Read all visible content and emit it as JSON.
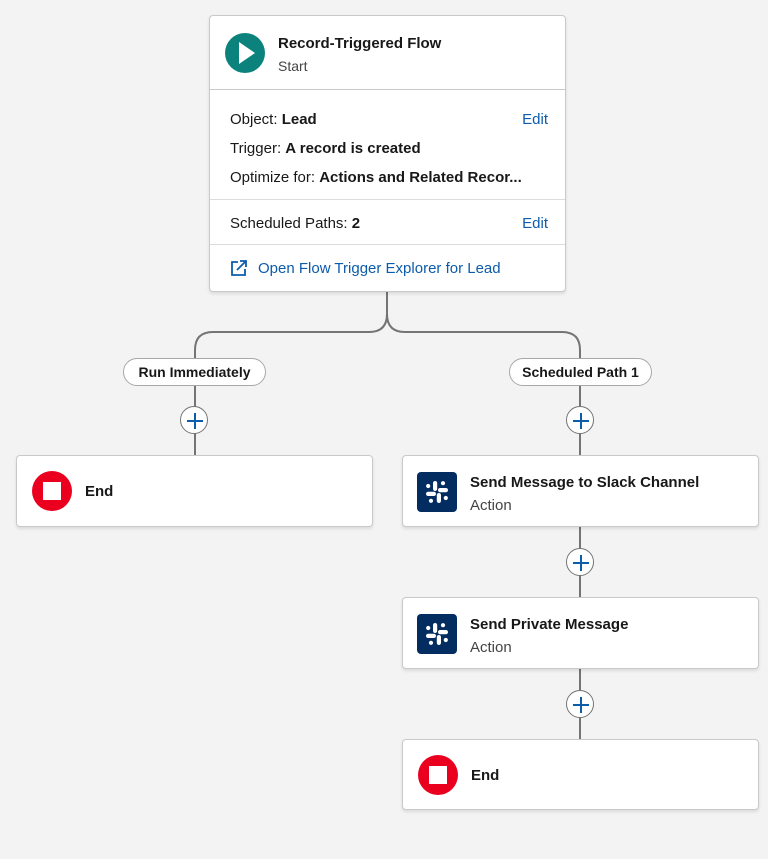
{
  "start": {
    "title": "Record-Triggered Flow",
    "subtitle": "Start",
    "object_label": "Object: ",
    "object_value": "Lead",
    "trigger_label": "Trigger: ",
    "trigger_value": "A record is created",
    "optimize_label": "Optimize for: ",
    "optimize_value": "Actions and Related Recor...",
    "edit_label": "Edit",
    "scheduled_label": "Scheduled Paths: ",
    "scheduled_value": "2",
    "scheduled_edit_label": "Edit",
    "explorer_link": "Open Flow Trigger Explorer for Lead"
  },
  "paths": {
    "left_label": "Run Immediately",
    "right_label": "Scheduled Path 1"
  },
  "nodes": {
    "left_end": {
      "title": "End"
    },
    "slack_channel": {
      "title": "Send Message to Slack Channel",
      "subtitle": "Action"
    },
    "private_message": {
      "title": "Send Private Message",
      "subtitle": "Action"
    },
    "right_end": {
      "title": "End"
    }
  },
  "icons": {
    "start": "play-icon",
    "end": "stop-icon",
    "action": "slack-icon",
    "add": "plus-icon",
    "link": "external-link-icon"
  },
  "colors": {
    "start_accent": "#0b827c",
    "end_accent": "#ea001e",
    "slack_bg": "#032d60",
    "link": "#0b5cab",
    "canvas": "#f3f3f3"
  }
}
